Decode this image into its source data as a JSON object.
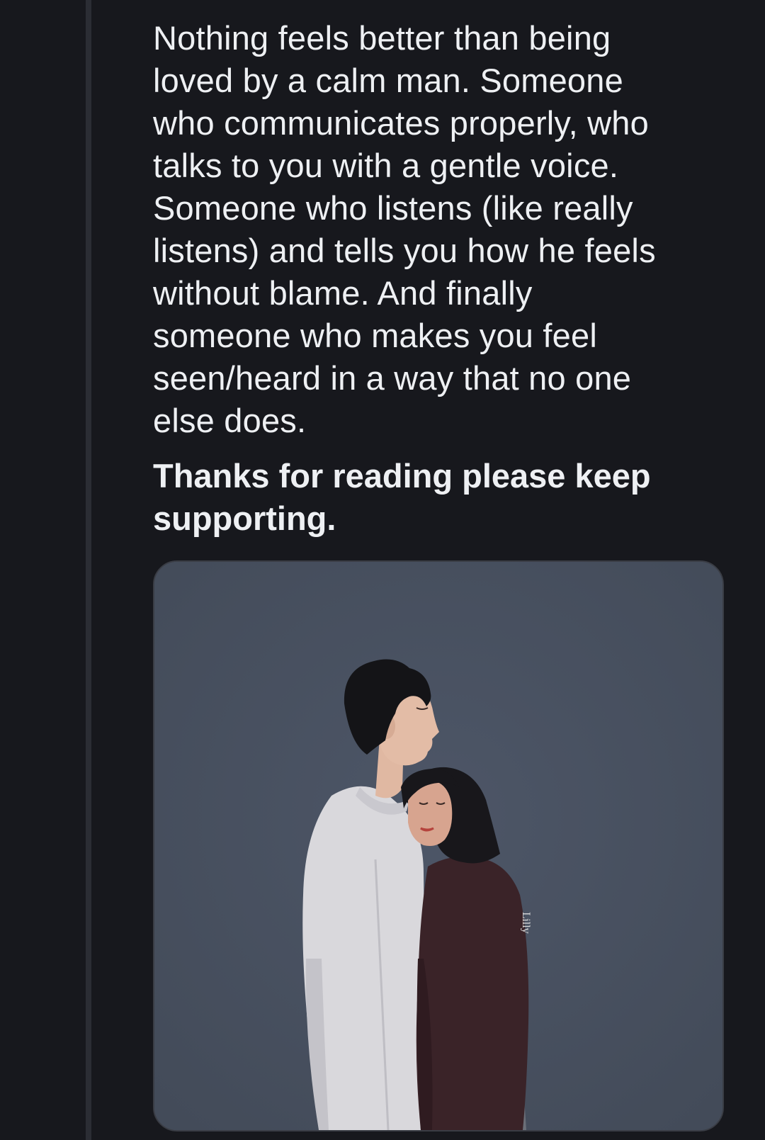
{
  "post": {
    "body_lines": [
      "Nothing feels better than being",
      "loved by a calm man. Someone",
      "who communicates properly, who",
      "talks to you with a gentle voice.",
      "Someone who listens (like really",
      "listens) and tells you how he feels",
      "without blame. And finally",
      "someone who makes you feel",
      "seen/heard in a way that no one",
      "else does."
    ],
    "closing": "Thanks for reading please keep supporting."
  },
  "media": {
    "alt": "illustration of a couple embracing",
    "artist_signature": "Lilly"
  },
  "colors": {
    "background": "#17181d",
    "thread_line": "#2b2d34",
    "text": "#eef0f3",
    "image_bg": "#4a5261"
  }
}
